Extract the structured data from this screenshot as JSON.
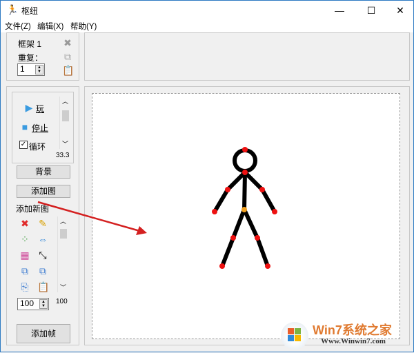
{
  "window": {
    "title": "枢纽",
    "minimize": "—",
    "maximize": "☐",
    "close": "✕"
  },
  "menu": [
    "文件(Z)",
    "编辑(X)",
    "帮助(Y)"
  ],
  "frame_panel": {
    "frame_label": "框架 1",
    "repeat_label": "重复：",
    "repeat_value": "1"
  },
  "playback": {
    "play": "玩",
    "stop": "停止",
    "loop": "循环",
    "loop_checked": true,
    "speed": "33.3"
  },
  "buttons": {
    "background": "背景",
    "add_figure": "添加图",
    "add_frame": "添加帧"
  },
  "figure_tools": {
    "label": "添加新图",
    "size_value": "100",
    "scale_readout": "100"
  },
  "watermark": {
    "brand": "Win7系统之家",
    "url": "Www.Winwin7.com"
  },
  "colors": {
    "joint": "#ee1111",
    "hip": "#f0a020",
    "arrow": "#d42020"
  }
}
